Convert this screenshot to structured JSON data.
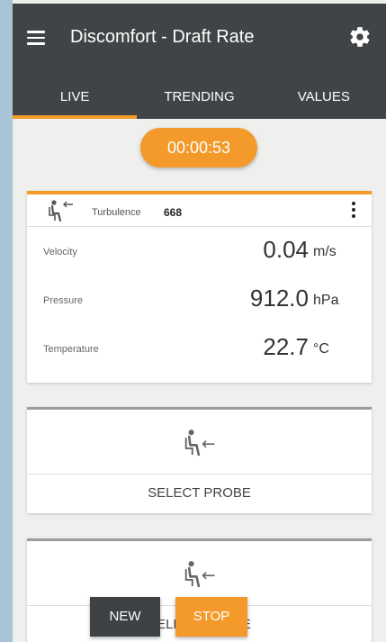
{
  "header": {
    "title": "Discomfort - Draft Rate"
  },
  "tabs": [
    {
      "label": "LIVE"
    },
    {
      "label": "TRENDING"
    },
    {
      "label": "VALUES"
    }
  ],
  "timer": "00:00:53",
  "probe": {
    "name": "Turbulence",
    "serial": "668",
    "readings": [
      {
        "label": "Velocity",
        "value": "0.04",
        "unit": "m/s"
      },
      {
        "label": "Pressure",
        "value": "912.0",
        "unit": "hPa"
      },
      {
        "label": "Temperature",
        "value": "22.7",
        "unit": "°C"
      }
    ]
  },
  "empty_slots": [
    {
      "label": "SELECT PROBE"
    },
    {
      "label": "SELECT PROBE"
    }
  ],
  "buttons": {
    "new": "NEW",
    "stop": "STOP"
  },
  "colors": {
    "accent": "#f39a2a",
    "appbar": "#414446",
    "background": "#efefee"
  }
}
